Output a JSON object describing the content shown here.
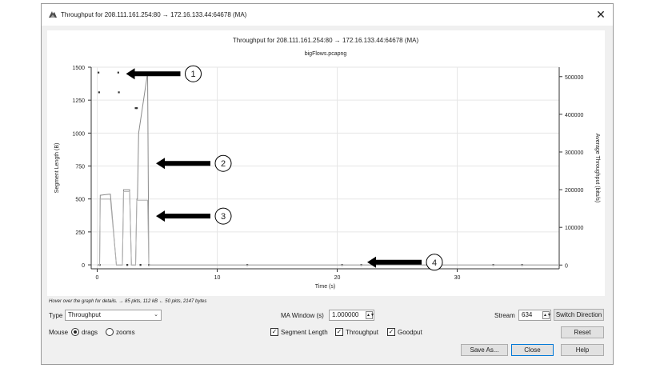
{
  "window": {
    "title": "Throughput for 208.111.161.254:80 → 172.16.133.44:64678 (MA)",
    "close_glyph": "✕",
    "icon": "shark-fin-icon"
  },
  "chart_data": {
    "type": "line",
    "title": "Throughput for 208.111.161.254:80 → 172.16.133.44:64678 (MA)",
    "subtitle": "bigFlows.pcapng",
    "xlabel": "Time (s)",
    "ylabel": "Segment Length (B)",
    "y2label": "Average Throughput (bits/s)",
    "xlim": [
      -0.5,
      38.5
    ],
    "ylim": [
      -30,
      1500
    ],
    "y2lim": [
      -10000,
      525000
    ],
    "x_ticks": [
      "0",
      "10",
      "20",
      "30"
    ],
    "x_tick_values": [
      0,
      10,
      20,
      30
    ],
    "y_ticks": [
      "0",
      "250",
      "500",
      "750",
      "1000",
      "1250",
      "1500"
    ],
    "y_tick_values": [
      0,
      250,
      500,
      750,
      1000,
      1250,
      1500
    ],
    "y2_ticks": [
      "0",
      "100000",
      "200000",
      "300000",
      "400000",
      "500000"
    ],
    "y2_tick_values": [
      0,
      100000,
      200000,
      300000,
      400000,
      500000
    ],
    "grid": true,
    "series": [
      {
        "name": "Segment Length",
        "kind": "scatter",
        "color": "#333333",
        "x": [
          0.1,
          0.15,
          1.75,
          1.8,
          3.2,
          3.3,
          0.2,
          2.5,
          3.6,
          4.3,
          12.5,
          20.4,
          22.0,
          27.8,
          33.0,
          35.4
        ],
        "y": [
          1460,
          1310,
          1460,
          1310,
          1190,
          1190,
          0,
          0,
          0,
          0,
          0,
          0,
          0,
          0,
          0,
          0
        ]
      },
      {
        "name": "Throughput",
        "kind": "line",
        "axis": "right",
        "color": "#8a8a8a",
        "x": [
          0.0,
          0.2,
          0.25,
          1.0,
          1.1,
          1.6,
          1.75,
          2.1,
          2.2,
          2.7,
          2.85,
          3.2,
          3.3,
          3.35,
          3.45,
          4.2,
          4.3,
          4.5,
          38.5
        ],
        "y": [
          0,
          0,
          185000,
          188000,
          188000,
          0,
          0,
          0,
          200000,
          200000,
          0,
          0,
          175000,
          175000,
          350000,
          510000,
          0,
          0,
          0
        ]
      },
      {
        "name": "Goodput",
        "kind": "line",
        "axis": "right",
        "color": "#b0b0b0",
        "x": [
          0.0,
          0.2,
          0.25,
          1.0,
          1.1,
          1.6,
          1.75,
          2.1,
          2.2,
          2.7,
          2.85,
          3.2,
          3.3,
          4.2,
          4.3,
          4.5,
          38.5
        ],
        "y": [
          0,
          0,
          175000,
          175000,
          175000,
          0,
          0,
          0,
          195000,
          195000,
          0,
          0,
          172000,
          172000,
          0,
          0,
          0
        ]
      }
    ],
    "annotations": [
      {
        "label": "1",
        "x": 2.4,
        "y": 1450
      },
      {
        "label": "2",
        "x": 4.9,
        "y": 770
      },
      {
        "label": "3",
        "x": 4.9,
        "y": 370
      },
      {
        "label": "4",
        "x": 22.5,
        "y": 20
      }
    ]
  },
  "hint": "Hover over the graph for details. → 85 pkts, 112 kB ← 50 pkts, 2147 bytes",
  "controls": {
    "type_label": "Type",
    "type_value": "Throughput",
    "ma_label": "MA Window (s)",
    "ma_value": "1.000000",
    "stream_label": "Stream",
    "stream_value": "634",
    "switch_direction": "Switch Direction",
    "mouse_label": "Mouse",
    "drags_label": "drags",
    "zooms_label": "zooms",
    "segment_length_label": "Segment Length",
    "throughput_label": "Throughput",
    "goodput_label": "Goodput",
    "reset_label": "Reset",
    "save_as_label": "Save As...",
    "close_label": "Close",
    "help_label": "Help"
  }
}
